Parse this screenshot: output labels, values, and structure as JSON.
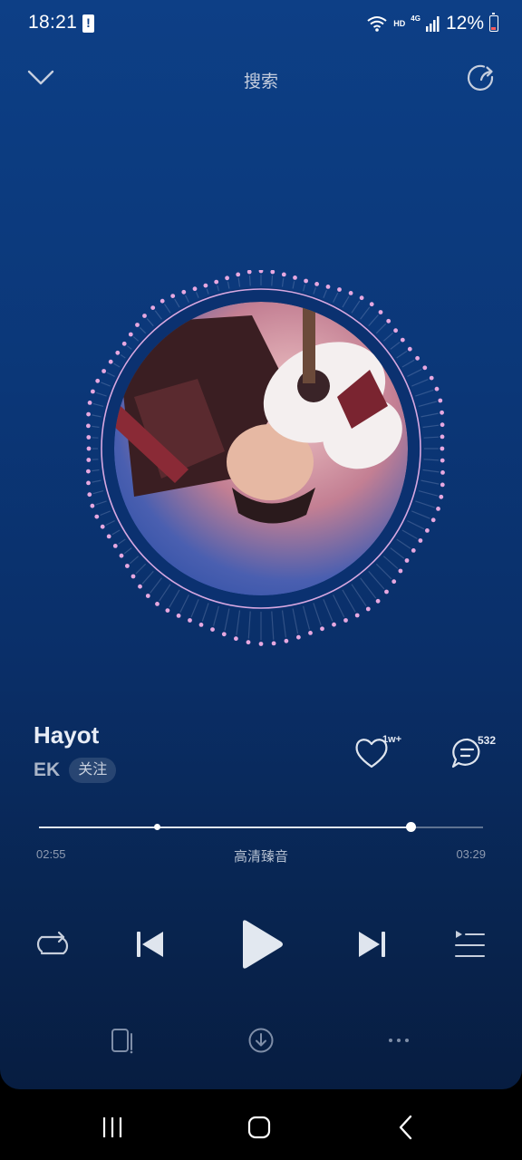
{
  "status_bar": {
    "time": "18:21",
    "network_hd": "HD",
    "network_type": "4G",
    "battery": "12%"
  },
  "header": {
    "title": "搜索"
  },
  "song": {
    "title": "Hayot",
    "artist": "EK",
    "follow_label": "关注",
    "likes_count": "1w+",
    "comments_count": "532"
  },
  "progress": {
    "current_time": "02:55",
    "total_time": "03:29",
    "quality_label": "高清臻音",
    "played_fraction": 0.837,
    "marker_fraction": 0.267
  },
  "colors": {
    "background_top": "#0d3f86",
    "background_bottom": "#071d41",
    "ring_dots": "#e7a8e0",
    "text_primary": "#e8edf6",
    "text_secondary": "#aab5c8"
  },
  "icons": {
    "collapse": "chevron-down-icon",
    "share": "share-icon",
    "like": "heart-icon",
    "comment": "comment-icon",
    "repeat": "repeat-icon",
    "previous": "skip-previous-icon",
    "play": "play-icon",
    "next": "skip-next-icon",
    "playlist": "playlist-icon",
    "device": "device-icon",
    "download": "download-icon",
    "more": "more-icon"
  }
}
